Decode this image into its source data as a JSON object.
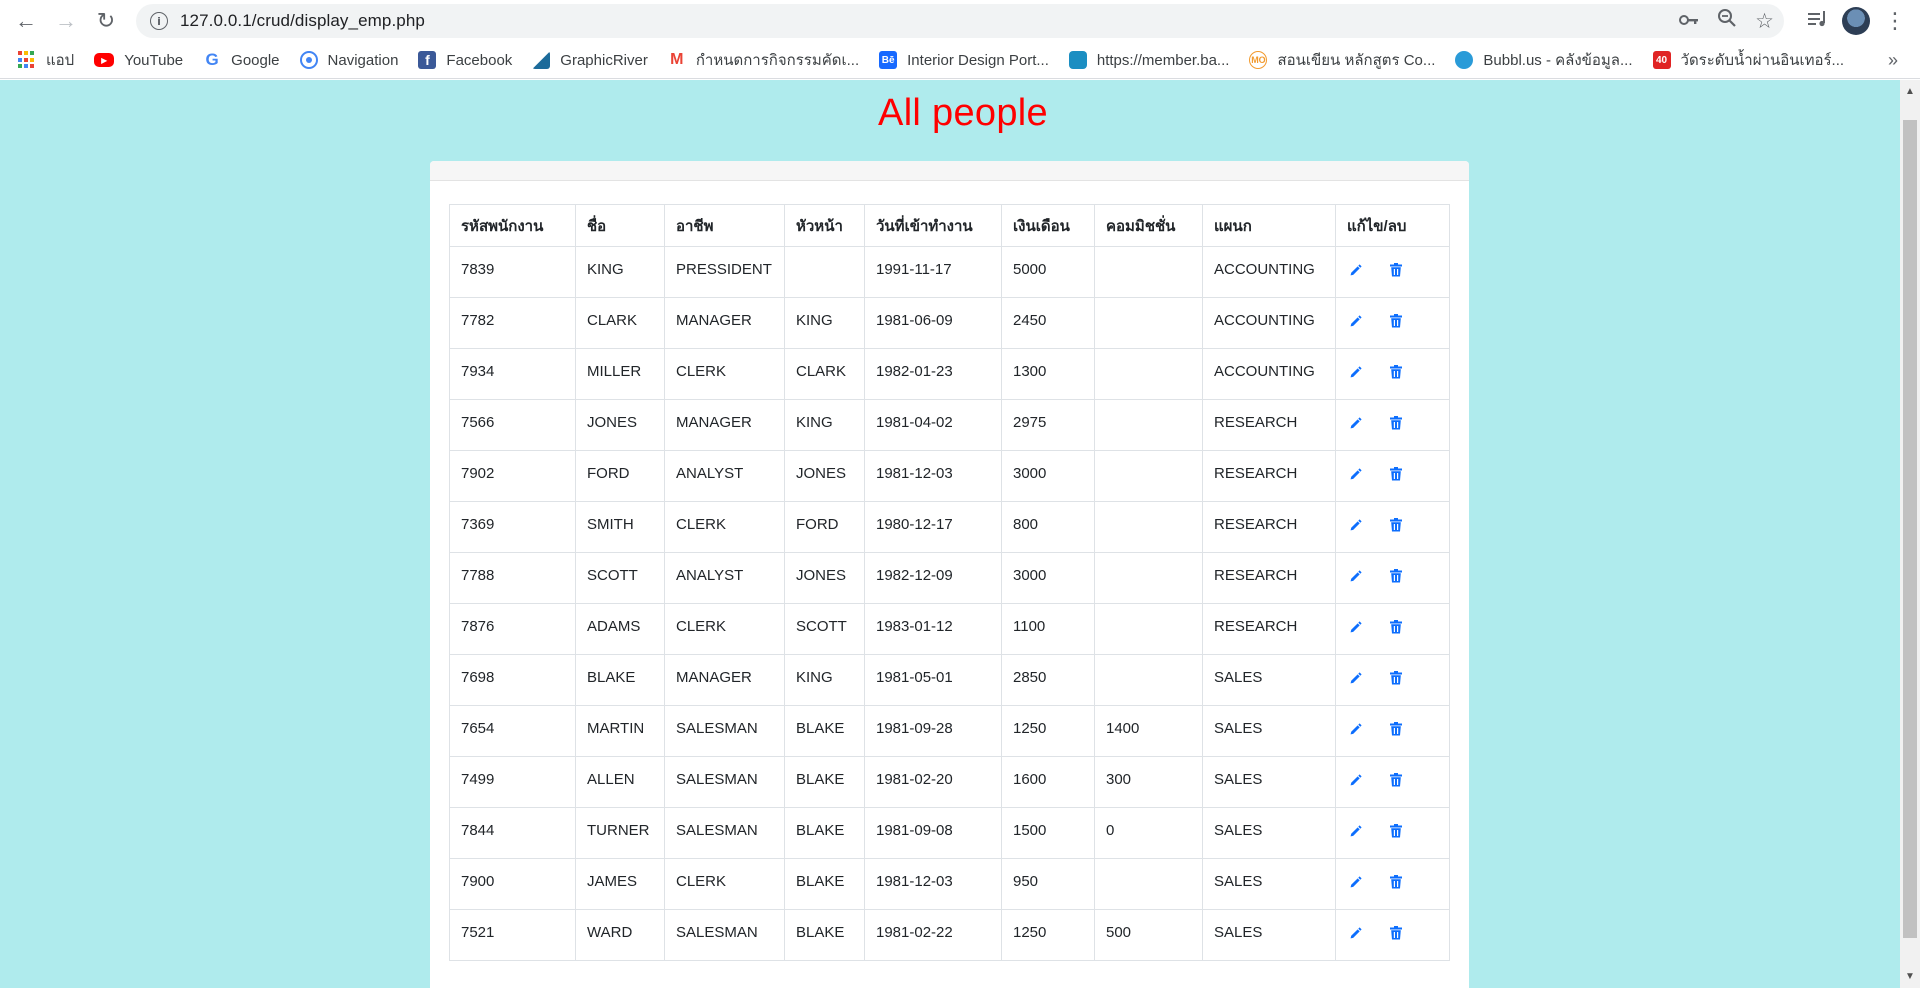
{
  "browser": {
    "url": "127.0.0.1/crud/display_emp.php",
    "bookmarks": [
      {
        "label": "แอป",
        "icon": "apps-grid-icon"
      },
      {
        "label": "YouTube",
        "icon": "youtube-icon"
      },
      {
        "label": "Google",
        "icon": "google-icon"
      },
      {
        "label": "Navigation",
        "icon": "navigation-icon"
      },
      {
        "label": "Facebook",
        "icon": "facebook-icon"
      },
      {
        "label": "GraphicRiver",
        "icon": "graphicriver-icon"
      },
      {
        "label": "กำหนดการกิจกรรมคัดเ...",
        "icon": "gmail-icon"
      },
      {
        "label": "Interior Design Port...",
        "icon": "behance-icon"
      },
      {
        "label": "https://member.ba...",
        "icon": "site-icon"
      },
      {
        "label": "สอนเขียน หลักสูตร Co...",
        "icon": "mo-icon"
      },
      {
        "label": "Bubbl.us - คลังข้อมูล...",
        "icon": "bubbl-icon"
      },
      {
        "label": "วัดระดับน้ำผ่านอินเทอร์...",
        "icon": "site-40-icon"
      }
    ]
  },
  "page": {
    "title": "All people",
    "background": "#afebed",
    "title_color": "#ff0000"
  },
  "table": {
    "headers": [
      "รหัสพนักงาน",
      "ชื่อ",
      "อาชีพ",
      "หัวหน้า",
      "วันที่เข้าทำงาน",
      "เงินเดือน",
      "คอมมิชชั่น",
      "แผนก",
      "แก้ไข/ลบ"
    ],
    "rows": [
      [
        "7839",
        "KING",
        "PRESSIDENT",
        "",
        "1991-11-17",
        "5000",
        "",
        "ACCOUNTING"
      ],
      [
        "7782",
        "CLARK",
        "MANAGER",
        "KING",
        "1981-06-09",
        "2450",
        "",
        "ACCOUNTING"
      ],
      [
        "7934",
        "MILLER",
        "CLERK",
        "CLARK",
        "1982-01-23",
        "1300",
        "",
        "ACCOUNTING"
      ],
      [
        "7566",
        "JONES",
        "MANAGER",
        "KING",
        "1981-04-02",
        "2975",
        "",
        "RESEARCH"
      ],
      [
        "7902",
        "FORD",
        "ANALYST",
        "JONES",
        "1981-12-03",
        "3000",
        "",
        "RESEARCH"
      ],
      [
        "7369",
        "SMITH",
        "CLERK",
        "FORD",
        "1980-12-17",
        "800",
        "",
        "RESEARCH"
      ],
      [
        "7788",
        "SCOTT",
        "ANALYST",
        "JONES",
        "1982-12-09",
        "3000",
        "",
        "RESEARCH"
      ],
      [
        "7876",
        "ADAMS",
        "CLERK",
        "SCOTT",
        "1983-01-12",
        "1100",
        "",
        "RESEARCH"
      ],
      [
        "7698",
        "BLAKE",
        "MANAGER",
        "KING",
        "1981-05-01",
        "2850",
        "",
        "SALES"
      ],
      [
        "7654",
        "MARTIN",
        "SALESMAN",
        "BLAKE",
        "1981-09-28",
        "1250",
        "1400",
        "SALES"
      ],
      [
        "7499",
        "ALLEN",
        "SALESMAN",
        "BLAKE",
        "1981-02-20",
        "1600",
        "300",
        "SALES"
      ],
      [
        "7844",
        "TURNER",
        "SALESMAN",
        "BLAKE",
        "1981-09-08",
        "1500",
        "0",
        "SALES"
      ],
      [
        "7900",
        "JAMES",
        "CLERK",
        "BLAKE",
        "1981-12-03",
        "950",
        "",
        "SALES"
      ],
      [
        "7521",
        "WARD",
        "SALESMAN",
        "BLAKE",
        "1981-02-22",
        "1250",
        "500",
        "SALES"
      ]
    ],
    "row_actions": {
      "edit_icon": "pencil-icon",
      "delete_icon": "trash-icon",
      "icon_color": "#0d6efd"
    }
  }
}
